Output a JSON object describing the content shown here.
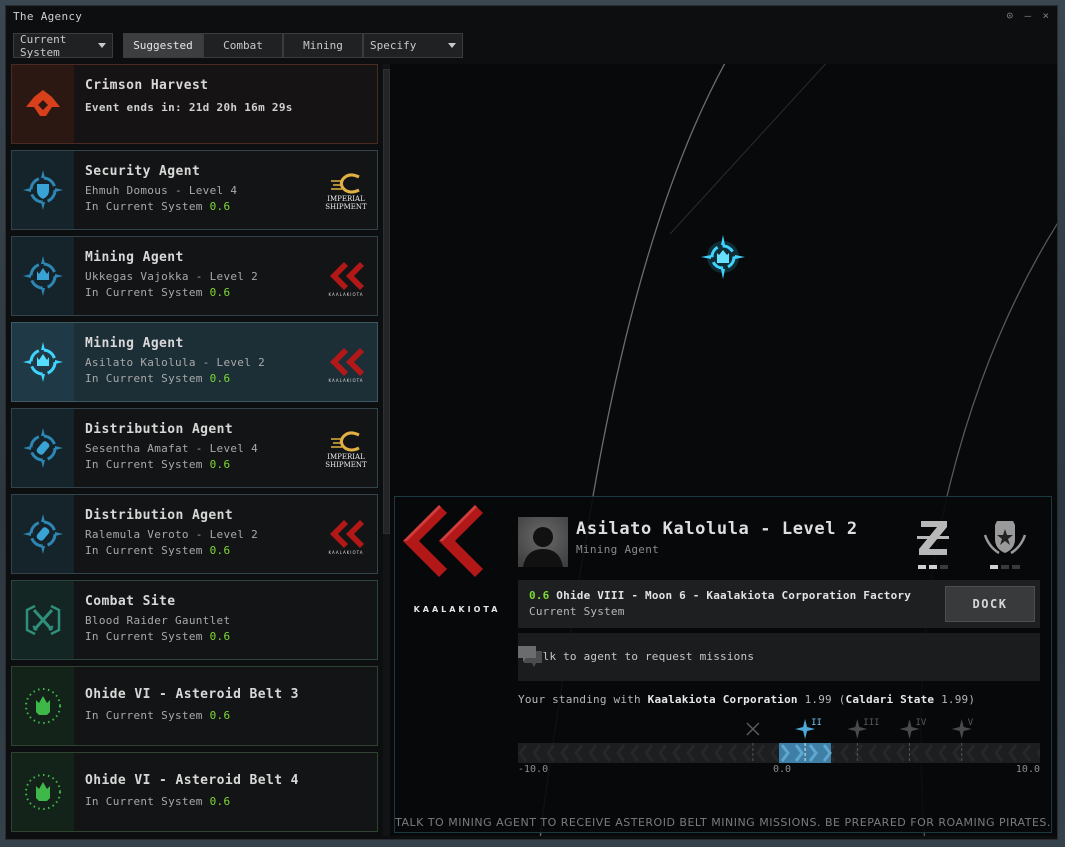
{
  "window": {
    "title": "The Agency",
    "controls": [
      "settings-icon",
      "minimize-icon",
      "close-icon"
    ]
  },
  "toolbar": {
    "location_filter": "Current System",
    "tabs": [
      {
        "label": "Suggested",
        "active": true
      },
      {
        "label": "Combat",
        "active": false
      },
      {
        "label": "Mining",
        "active": false
      }
    ],
    "specify_label": "Specify"
  },
  "cards": [
    {
      "kind": "event",
      "title": "Crimson Harvest",
      "sub": "Event ends in: 21d 20h 16m 29s",
      "icon": "crimson-harvest-icon"
    },
    {
      "kind": "agent",
      "title": "Security Agent",
      "sub": "Ehmuh Domous - Level 4",
      "loc": "In Current System",
      "sec": "0.6",
      "icon": "security-agent-icon",
      "corp": "Imperial Shipment"
    },
    {
      "kind": "agent",
      "title": "Mining Agent",
      "sub": "Ukkegas Vajokka - Level 2",
      "loc": "In Current System",
      "sec": "0.6",
      "icon": "mining-agent-icon",
      "corp": "Kaalakiota"
    },
    {
      "kind": "agent",
      "title": "Mining Agent",
      "sub": "Asilato Kalolula - Level 2",
      "loc": "In Current System",
      "sec": "0.6",
      "icon": "mining-agent-icon",
      "corp": "Kaalakiota",
      "selected": true
    },
    {
      "kind": "agent",
      "title": "Distribution Agent",
      "sub": "Sesentha Amafat - Level 4",
      "loc": "In Current System",
      "sec": "0.6",
      "icon": "distribution-agent-icon",
      "corp": "Imperial Shipment"
    },
    {
      "kind": "agent",
      "title": "Distribution Agent",
      "sub": "Ralemula Veroto - Level 2",
      "loc": "In Current System",
      "sec": "0.6",
      "icon": "distribution-agent-icon",
      "corp": "Kaalakiota"
    },
    {
      "kind": "combat",
      "title": "Combat Site",
      "sub": "Blood Raider Gauntlet",
      "loc": "In Current System",
      "sec": "0.6",
      "icon": "combat-site-icon"
    },
    {
      "kind": "belt",
      "title": "Ohide VI - Asteroid Belt 3",
      "loc": "In Current System",
      "sec": "0.6",
      "icon": "asteroid-belt-icon"
    },
    {
      "kind": "belt",
      "title": "Ohide VI - Asteroid Belt 4",
      "loc": "In Current System",
      "sec": "0.6",
      "icon": "asteroid-belt-icon"
    }
  ],
  "corp_logos": {
    "imperial_line1": "IMPERIAL",
    "imperial_line2": "SHIPMENT",
    "kaalakiota_small": "KAALAKIOTA"
  },
  "detail": {
    "corp_name": "KAALAKIOTA",
    "agent_name": "Asilato Kalolula - Level 2",
    "agent_type": "Mining Agent",
    "faction_pips": {
      "faction_z": [
        true,
        true,
        false
      ],
      "faction_shield": [
        true,
        false,
        false
      ]
    },
    "location": {
      "security": "0.6",
      "station": "Ohide VIII - Moon 6 - Kaalakiota Corporation Factory",
      "system": "Current System"
    },
    "dock_label": "DOCK",
    "talk_label": "Talk to agent to request missions",
    "standing": {
      "prefix": "Your standing with",
      "corp": "Kaalakiota Corporation",
      "corp_value": "1.99",
      "faction": "Caldari State",
      "faction_value": "1.99"
    },
    "standing_bar": {
      "min": -10.0,
      "max": 10.0,
      "value": 1.99,
      "min_label": "-10.0",
      "mid_label": "0.0",
      "max_label": "10.0",
      "level_markers": [
        {
          "label": "",
          "threshold": -1.0,
          "reached": true
        },
        {
          "label": "II",
          "threshold": 1.0,
          "reached": true,
          "current": true
        },
        {
          "label": "III",
          "threshold": 3.0,
          "reached": false
        },
        {
          "label": "IV",
          "threshold": 5.0,
          "reached": false
        },
        {
          "label": "V",
          "threshold": 7.0,
          "reached": false
        }
      ]
    },
    "hint": "TALK TO MINING AGENT TO RECEIVE ASTEROID BELT MINING MISSIONS. BE PREPARED FOR ROAMING PIRATES."
  },
  "colors": {
    "security_green": "#7fd836",
    "agent_blue": "#3aa3d6",
    "selected_cyan": "#3fd4ff",
    "event_red": "#d8401c",
    "belt_green": "#3fb84a",
    "combat_teal": "#2f8f7c",
    "kaalakiota_red": "#b21818",
    "imperial_gold": "#e0b042"
  }
}
